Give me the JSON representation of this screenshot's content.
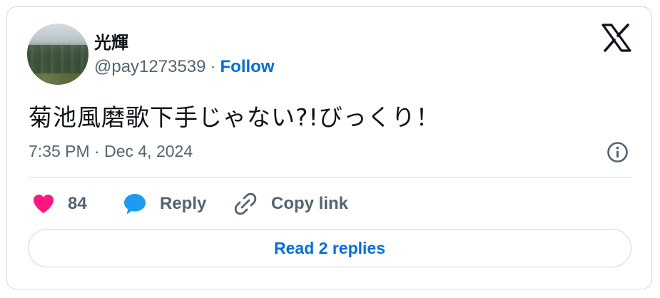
{
  "user": {
    "name": "光輝",
    "handle": "@pay1273539",
    "separator": "·",
    "follow_label": "Follow"
  },
  "tweet": {
    "text": "菊池風磨歌下手じゃない?!びっくり！",
    "timestamp": "7:35 PM · Dec 4, 2024"
  },
  "actions": {
    "likes_count": "84",
    "reply_label": "Reply",
    "copy_link_label": "Copy link"
  },
  "read_replies_label": "Read 2 replies",
  "icons": {
    "brand": "x-logo-icon",
    "info": "info-icon",
    "like": "heart-icon",
    "reply": "speech-bubble-icon",
    "copy": "link-icon"
  },
  "colors": {
    "accent": "#006fd6",
    "heart": "#f91880",
    "reply": "#1d9bf0",
    "muted": "#536471",
    "border": "#cfd9de"
  }
}
